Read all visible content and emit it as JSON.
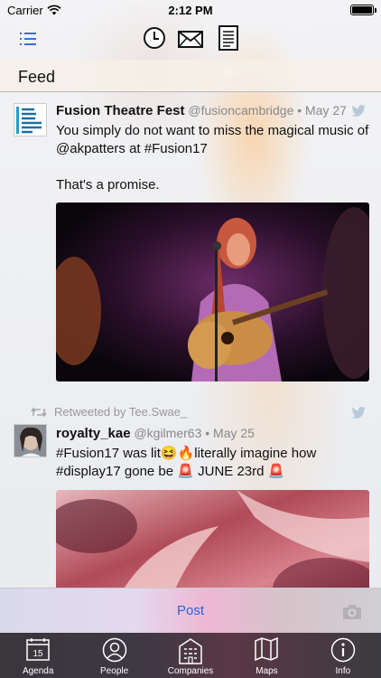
{
  "status_bar": {
    "carrier": "Carrier",
    "time": "2:12 PM"
  },
  "top_nav": {
    "icons": [
      "menu-list-icon",
      "clock-icon",
      "mail-icon",
      "document-icon"
    ],
    "accent_color": "#3b6fd6"
  },
  "feed": {
    "title": "Feed",
    "tweets": [
      {
        "name": "Fusion Theatre Fest",
        "handle": "@fusioncambridge",
        "sep": "•",
        "date": "May 27",
        "text_line1": "You simply do not want to miss the magical music of @akpatters at #Fusion17",
        "text_line2": "That's a promise.",
        "avatar_text": "FUSION THEATRE FESTIVAL CAMBRIDGE",
        "media": "photo-singer-guitar"
      },
      {
        "retweeted_by": "Retweeted by Tee.Swae_",
        "name": "royalty_kae",
        "handle": "@kgilmer63",
        "sep": "•",
        "date": "May 25",
        "text_line1": "#Fusion17 was lit😆🔥literally imagine how",
        "text_line2": "#display17 gone be 🚨 JUNE 23rd 🚨",
        "media": "photo-blurred-crowd"
      }
    ]
  },
  "post_bar": {
    "post_label": "Post",
    "camera_icon": "camera-icon"
  },
  "tab_bar": {
    "calendar_day": "15",
    "tabs": [
      {
        "label": "Agenda",
        "icon": "calendar-icon"
      },
      {
        "label": "People",
        "icon": "person-icon"
      },
      {
        "label": "Companies",
        "icon": "building-icon"
      },
      {
        "label": "Maps",
        "icon": "map-icon"
      },
      {
        "label": "Info",
        "icon": "info-icon"
      }
    ]
  }
}
